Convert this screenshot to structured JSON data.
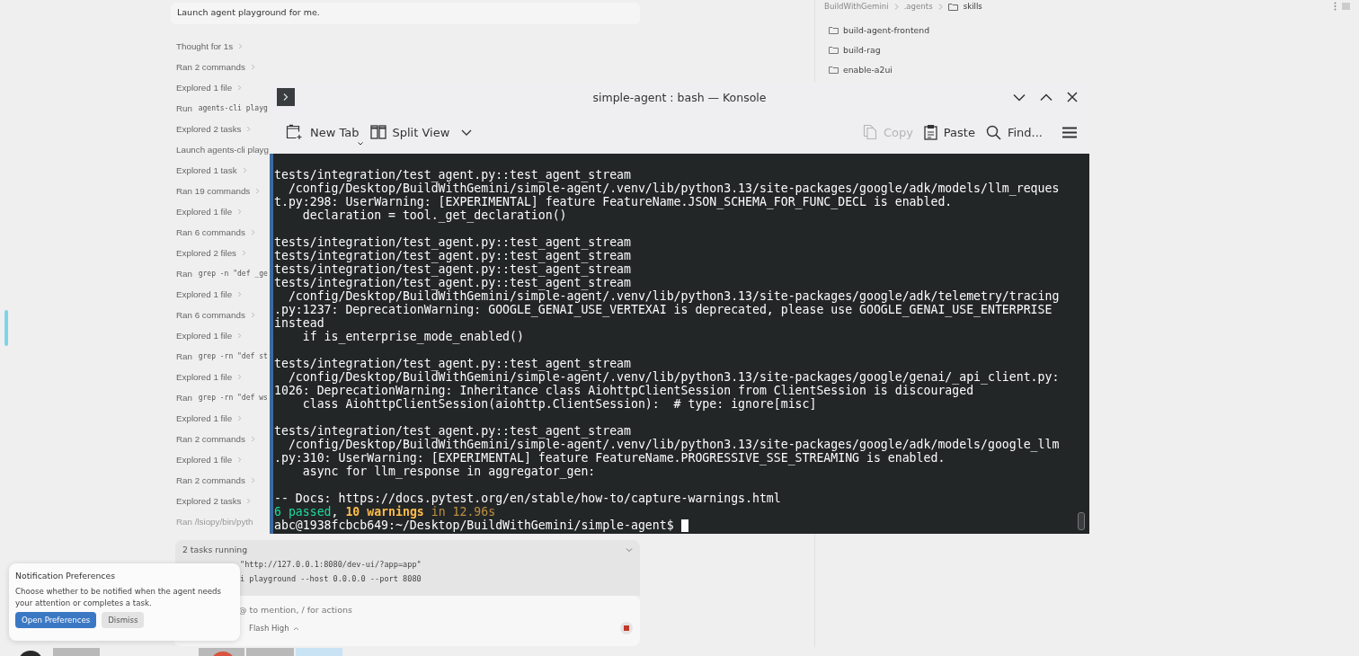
{
  "chat": {
    "message": "Launch agent playground for me.",
    "steps": [
      {
        "kind": "summary",
        "text": "Thought for 1s"
      },
      {
        "kind": "summary",
        "text": "Ran 2 commands"
      },
      {
        "kind": "summary",
        "text": "Explored 1 file"
      },
      {
        "kind": "command",
        "text": "Run",
        "code": "agents-cli playg"
      },
      {
        "kind": "summary",
        "text": "Explored 2 tasks"
      },
      {
        "kind": "plain",
        "text": "Launch agents-cli playg"
      },
      {
        "kind": "summary",
        "text": "Explored 1 task"
      },
      {
        "kind": "summary",
        "text": "Ran 19 commands"
      },
      {
        "kind": "summary",
        "text": "Explored 1 file"
      },
      {
        "kind": "summary",
        "text": "Ran 6 commands"
      },
      {
        "kind": "summary",
        "text": "Explored 2 files"
      },
      {
        "kind": "command",
        "text": "Ran",
        "code": "grep -n \"def _ge"
      },
      {
        "kind": "summary",
        "text": "Explored 1 file"
      },
      {
        "kind": "summary",
        "text": "Ran 6 commands"
      },
      {
        "kind": "summary",
        "text": "Explored 1 file"
      },
      {
        "kind": "command",
        "text": "Ran",
        "code": "grep -rn \"def st"
      },
      {
        "kind": "summary",
        "text": "Explored 1 file"
      },
      {
        "kind": "command",
        "text": "Ran",
        "code": "grep -rn \"def ws"
      },
      {
        "kind": "summary",
        "text": "Explored 1 file"
      },
      {
        "kind": "summary",
        "text": "Ran 2 commands"
      },
      {
        "kind": "summary",
        "text": "Explored 1 file"
      },
      {
        "kind": "summary",
        "text": "Ran 2 commands"
      },
      {
        "kind": "summary",
        "text": "Explored 2 tasks"
      },
      {
        "kind": "pending",
        "text": "Ran /lsiopy/bin/pyth"
      }
    ],
    "tasks": {
      "title": "2 tasks running",
      "lines": [
        "\"http://127.0.0.1:8080/dev-ui/?app=app\"",
        "i playground --host 0.0.0.0 --port 8080"
      ]
    },
    "composer": {
      "placeholder": "@ to mention, / for actions",
      "model": "Flash High"
    }
  },
  "notification": {
    "title": "Notification Preferences",
    "body": "Choose whether to be notified when the agent needs your attention or completes a task.",
    "buttons": [
      {
        "label": "Open Preferences",
        "kind": "primary"
      },
      {
        "label": "Dismiss",
        "kind": "secondary"
      }
    ]
  },
  "explorer": {
    "breadcrumb": [
      "BuildWithGemini",
      ".agents",
      "skills"
    ],
    "folders": [
      "build-agent-frontend",
      "build-rag",
      "enable-a2ui"
    ]
  },
  "konsole": {
    "title": "simple-agent : bash — Konsole",
    "toolbar": [
      {
        "label": "New Tab",
        "kind": "new-tab",
        "disabled": false
      },
      {
        "label": "Split View",
        "kind": "split",
        "disabled": false
      },
      {
        "label": "Copy",
        "kind": "copy",
        "disabled": true
      },
      {
        "label": "Paste",
        "kind": "paste",
        "disabled": false
      },
      {
        "label": "Find...",
        "kind": "find",
        "disabled": false
      }
    ],
    "blocks": [
      [
        {
          "kind": "text",
          "text": "tests/integration/test_agent.py::test_agent_stream"
        },
        {
          "kind": "text",
          "text": "  /config/Desktop/BuildWithGemini/simple-agent/.venv/lib/python3.13/site-packages/google/adk/models/llm_reques"
        },
        {
          "kind": "text",
          "text": "t.py:298: UserWarning: [EXPERIMENTAL] feature FeatureName.JSON_SCHEMA_FOR_FUNC_DECL is enabled."
        },
        {
          "kind": "text",
          "text": "    declaration = tool._get_declaration()"
        }
      ],
      [
        {
          "kind": "text",
          "text": "tests/integration/test_agent.py::test_agent_stream"
        },
        {
          "kind": "text",
          "text": "tests/integration/test_agent.py::test_agent_stream"
        },
        {
          "kind": "text",
          "text": "tests/integration/test_agent.py::test_agent_stream"
        },
        {
          "kind": "text",
          "text": "tests/integration/test_agent.py::test_agent_stream"
        },
        {
          "kind": "text",
          "text": "  /config/Desktop/BuildWithGemini/simple-agent/.venv/lib/python3.13/site-packages/google/adk/telemetry/tracing"
        },
        {
          "kind": "text",
          "text": ".py:1237: DeprecationWarning: GOOGLE_GENAI_USE_VERTEXAI is deprecated, please use GOOGLE_GENAI_USE_ENTERPRISE"
        },
        {
          "kind": "text",
          "text": "instead"
        },
        {
          "kind": "text",
          "text": "    if is_enterprise_mode_enabled()"
        }
      ],
      [
        {
          "kind": "text",
          "text": "tests/integration/test_agent.py::test_agent_stream"
        },
        {
          "kind": "text",
          "text": "  /config/Desktop/BuildWithGemini/simple-agent/.venv/lib/python3.13/site-packages/google/genai/_api_client.py:"
        },
        {
          "kind": "text",
          "text": "1026: DeprecationWarning: Inheritance class AiohttpClientSession from ClientSession is discouraged"
        },
        {
          "kind": "text",
          "text": "    class AiohttpClientSession(aiohttp.ClientSession):  # type: ignore[misc]"
        }
      ],
      [
        {
          "kind": "text",
          "text": "tests/integration/test_agent.py::test_agent_stream"
        },
        {
          "kind": "text",
          "text": "  /config/Desktop/BuildWithGemini/simple-agent/.venv/lib/python3.13/site-packages/google/adk/models/google_llm"
        },
        {
          "kind": "text",
          "text": ".py:310: UserWarning: [EXPERIMENTAL] feature FeatureName.PROGRESSIVE_SSE_STREAMING is enabled."
        },
        {
          "kind": "text",
          "text": "    async for llm_response in aggregator_gen:"
        }
      ],
      [
        {
          "kind": "text",
          "text": "-- Docs: https://docs.pytest.org/en/stable/how-to/capture-warnings.html"
        },
        {
          "kind": "summary",
          "passed": "6 passed",
          "sep": ", ",
          "warnings": "10 warnings",
          "time": " in 12.96s"
        },
        {
          "kind": "prompt",
          "text": "abc@1938fcbcb649:~/Desktop/BuildWithGemini/simple-agent$ ",
          "cursor": true
        }
      ]
    ]
  }
}
